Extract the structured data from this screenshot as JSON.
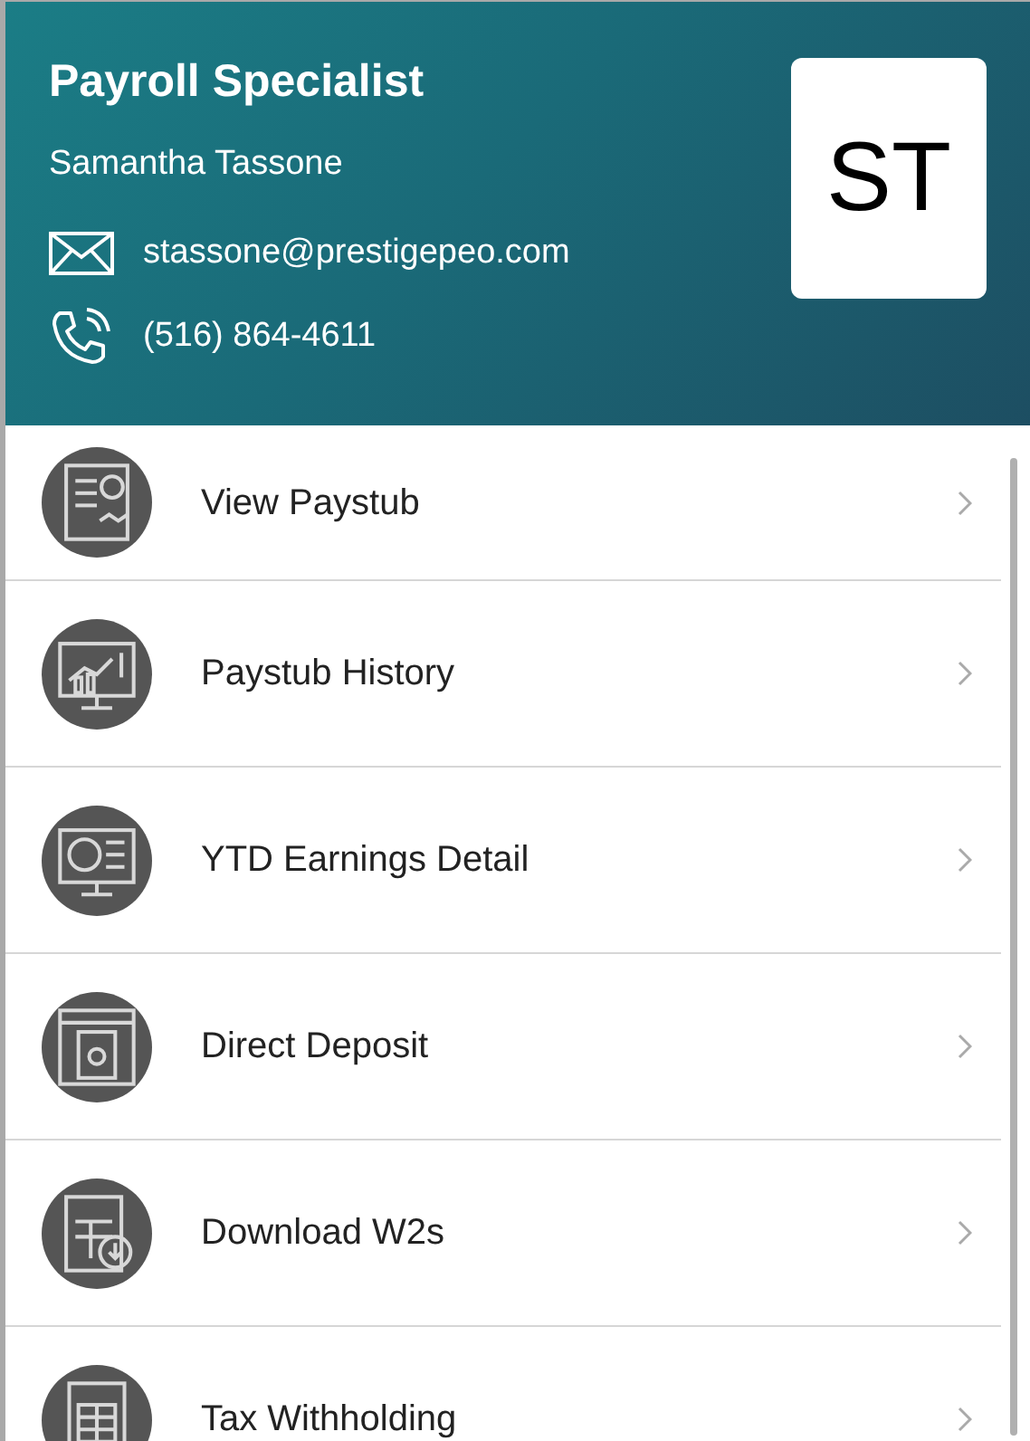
{
  "header": {
    "title": "Payroll Specialist",
    "name": "Samantha Tassone",
    "email": "stassone@prestigepeo.com",
    "phone": "(516) 864-4611",
    "avatar_initials": "ST"
  },
  "menu": [
    {
      "label": "View Paystub"
    },
    {
      "label": "Paystub History"
    },
    {
      "label": "YTD Earnings Detail"
    },
    {
      "label": "Direct Deposit"
    },
    {
      "label": "Download W2s"
    },
    {
      "label": "Tax Withholding"
    }
  ]
}
